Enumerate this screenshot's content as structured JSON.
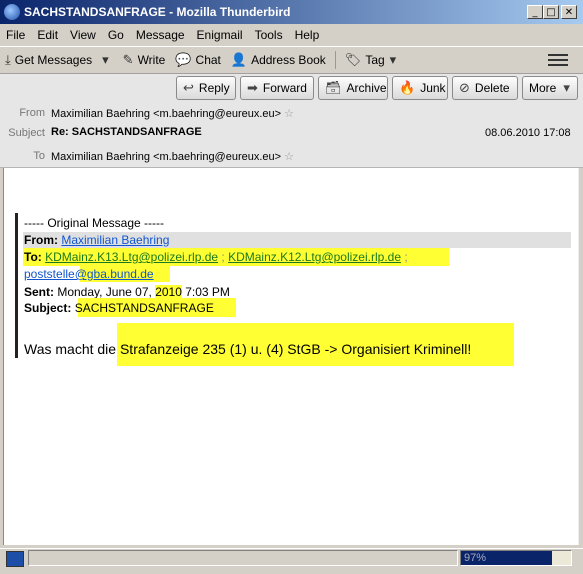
{
  "window": {
    "title": "SACHSTANDSANFRAGE - Mozilla Thunderbird",
    "min": "_",
    "max": "□",
    "close": "✕"
  },
  "menu": [
    "File",
    "Edit",
    "View",
    "Go",
    "Message",
    "Enigmail",
    "Tools",
    "Help"
  ],
  "toolbar": {
    "get_messages": "Get Messages",
    "write": "Write",
    "chat": "Chat",
    "address_book": "Address Book",
    "tag": "Tag"
  },
  "actions": {
    "reply": "Reply",
    "forward": "Forward",
    "archive": "Archive",
    "junk": "Junk",
    "delete": "Delete",
    "more": "More"
  },
  "header": {
    "from_label": "From",
    "from_value": "Maximilian Baehring <m.baehring@eureux.eu>",
    "subject_label": "Subject",
    "subject_value": "Re: SACHSTANDSANFRAGE",
    "date": "08.06.2010 17:08",
    "to_label": "To",
    "to_value": "Maximilian Baehring <m.baehring@eureux.eu>"
  },
  "message": {
    "original_heading": "----- Original Message -----",
    "from_label": "From:",
    "from_name": "Maximilian Baehring",
    "to_label": "To:",
    "to_addr_1": "KDMainz.K13.Ltg@polizei.rlp.de",
    "to_sep_1": " ; ",
    "to_addr_2": "KDMainz.K12.Ltg@polizei.rlp.de",
    "to_sep_2": " ;",
    "to_addr_3": "poststelle@gba.bund.de",
    "sent_label": "Sent:",
    "sent_value_a": " Monday, June 07, ",
    "sent_value_year": "2010",
    "sent_value_b": " 7:03 PM",
    "subject_label": "Subject:",
    "subject_value": "SACHSTANDSANFRAGE",
    "body_prefix": "Was macht die ",
    "body_highlight": "Strafanzeige 235 (1) u. (4) StGB -> Organisiert Kriminell!"
  },
  "status": {
    "progress_text": "97%",
    "progress_value": 0.97
  }
}
